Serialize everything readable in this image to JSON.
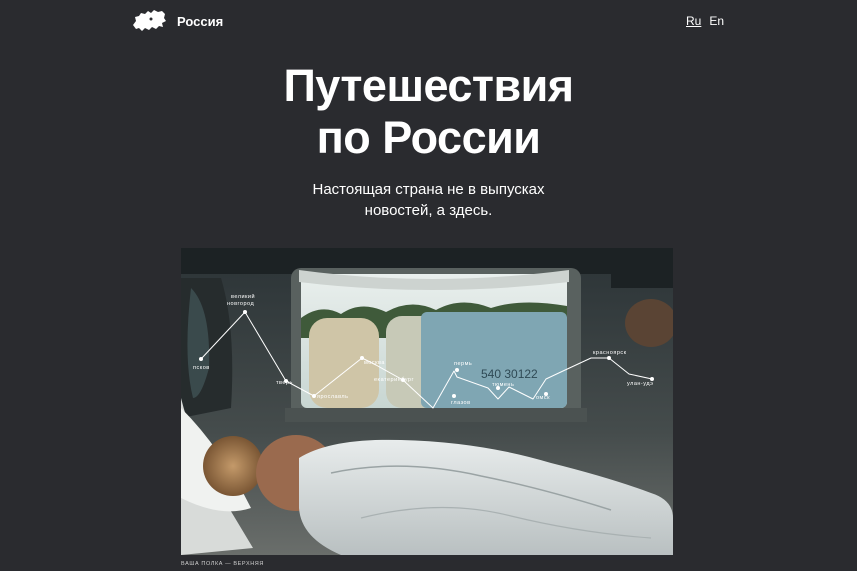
{
  "brand": {
    "name": "Россия",
    "logo_icon": "russia-map-icon"
  },
  "languages": [
    {
      "label": "Ru",
      "active": true
    },
    {
      "label": "En",
      "active": false
    }
  ],
  "hero": {
    "title_line1": "Путешествия",
    "title_line2": "по России",
    "subtitle_line1": "Настоящая страна не в выпусках",
    "subtitle_line2": "новостей, а здесь.",
    "caption": "ваша полка — верхняя"
  },
  "route": {
    "cities": [
      {
        "name": "псков"
      },
      {
        "name": "великий новгород",
        "line1": "великий",
        "line2": "новгород"
      },
      {
        "name": "тверь"
      },
      {
        "name": "ярославль"
      },
      {
        "name": "москва"
      },
      {
        "name": "екатеринбург"
      },
      {
        "name": "пермь"
      },
      {
        "name": "глазов"
      },
      {
        "name": "тюмень"
      },
      {
        "name": "омск"
      },
      {
        "name": "красноярск"
      },
      {
        "name": "улан-удэ"
      }
    ]
  },
  "colors": {
    "background": "#2a2b2f",
    "text": "#ffffff"
  }
}
